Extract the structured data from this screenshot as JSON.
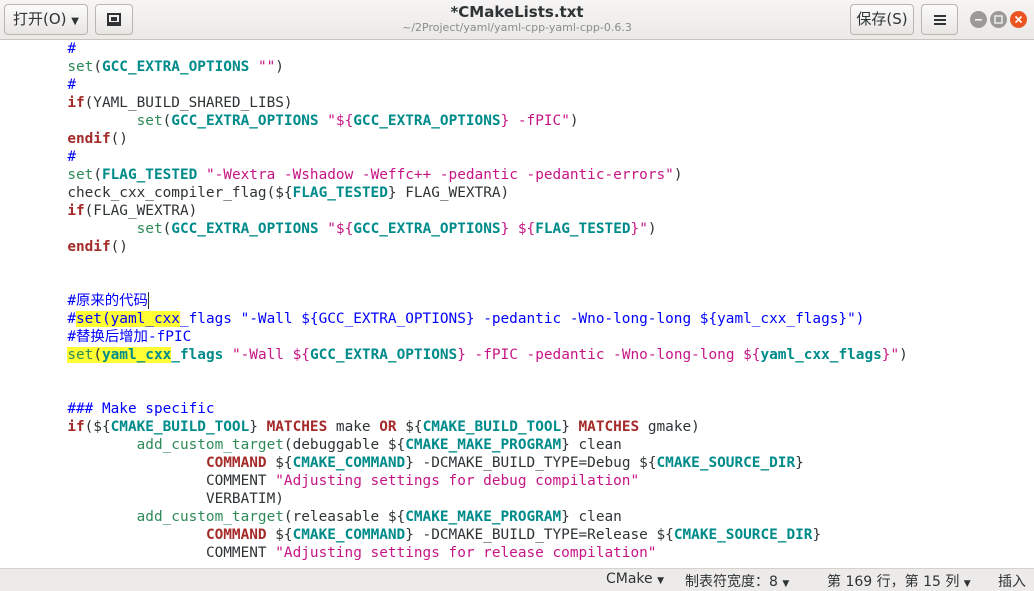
{
  "window": {
    "title": "*CMakeLists.txt",
    "subtitle": "~/2Project/yaml/yaml-cpp-yaml-cpp-0.6.3"
  },
  "toolbar": {
    "open_label": "打开(O)",
    "open_icon": "chevron-down-icon",
    "pin_icon": "document-pin-icon",
    "save_label": "保存(S)",
    "menu_icon": "hamburger-menu-icon"
  },
  "window_controls": {
    "minimize_icon": "minimize-icon",
    "maximize_icon": "maximize-icon",
    "close_icon": "close-icon",
    "close_color": "#e95420",
    "button_color": "#9c9a97"
  },
  "colors": {
    "keyword": "#a52a2a",
    "function": "#2e8b57",
    "variable": "#008b8b",
    "string": "#c71585",
    "comment": "#0000ff",
    "highlight": "#ffff33",
    "text": "#2e3436"
  },
  "editor": {
    "lines": [
      {
        "segments": [
          {
            "t": "\t#",
            "c": "comment"
          }
        ]
      },
      {
        "segments": [
          {
            "t": "\t"
          },
          {
            "t": "set",
            "c": "function"
          },
          {
            "t": "("
          },
          {
            "t": "GCC_EXTRA_OPTIONS",
            "c": "variable",
            "b": true
          },
          {
            "t": " "
          },
          {
            "t": "\"\"",
            "c": "string"
          },
          {
            "t": ")"
          }
        ]
      },
      {
        "segments": [
          {
            "t": "\t#",
            "c": "comment"
          }
        ]
      },
      {
        "segments": [
          {
            "t": "\t"
          },
          {
            "t": "if",
            "c": "keyword",
            "b": true
          },
          {
            "t": "(YAML_BUILD_SHARED_LIBS)"
          }
        ]
      },
      {
        "segments": [
          {
            "t": "\t\t"
          },
          {
            "t": "set",
            "c": "function"
          },
          {
            "t": "("
          },
          {
            "t": "GCC_EXTRA_OPTIONS",
            "c": "variable",
            "b": true
          },
          {
            "t": " "
          },
          {
            "t": "\"${",
            "c": "string"
          },
          {
            "t": "GCC_EXTRA_OPTIONS",
            "c": "variable",
            "b": true
          },
          {
            "t": "} -fPIC\"",
            "c": "string"
          },
          {
            "t": ")"
          }
        ]
      },
      {
        "segments": [
          {
            "t": "\t"
          },
          {
            "t": "endif",
            "c": "keyword",
            "b": true
          },
          {
            "t": "()"
          }
        ]
      },
      {
        "segments": [
          {
            "t": "\t#",
            "c": "comment"
          }
        ]
      },
      {
        "segments": [
          {
            "t": "\t"
          },
          {
            "t": "set",
            "c": "function"
          },
          {
            "t": "("
          },
          {
            "t": "FLAG_TESTED",
            "c": "variable",
            "b": true
          },
          {
            "t": " "
          },
          {
            "t": "\"-Wextra -Wshadow -Weffc++ -pedantic -pedantic-errors\"",
            "c": "string"
          },
          {
            "t": ")"
          }
        ]
      },
      {
        "segments": [
          {
            "t": "\tcheck_cxx_compiler_flag(${"
          },
          {
            "t": "FLAG_TESTED",
            "c": "variable",
            "b": true
          },
          {
            "t": "} FLAG_WEXTRA)"
          }
        ]
      },
      {
        "segments": [
          {
            "t": "\t"
          },
          {
            "t": "if",
            "c": "keyword",
            "b": true
          },
          {
            "t": "(FLAG_WEXTRA)"
          }
        ]
      },
      {
        "segments": [
          {
            "t": "\t\t"
          },
          {
            "t": "set",
            "c": "function"
          },
          {
            "t": "("
          },
          {
            "t": "GCC_EXTRA_OPTIONS",
            "c": "variable",
            "b": true
          },
          {
            "t": " "
          },
          {
            "t": "\"${",
            "c": "string"
          },
          {
            "t": "GCC_EXTRA_OPTIONS",
            "c": "variable",
            "b": true
          },
          {
            "t": "} ${",
            "c": "string"
          },
          {
            "t": "FLAG_TESTED",
            "c": "variable",
            "b": true
          },
          {
            "t": "}\"",
            "c": "string"
          },
          {
            "t": ")"
          }
        ]
      },
      {
        "segments": [
          {
            "t": "\t"
          },
          {
            "t": "endif",
            "c": "keyword",
            "b": true
          },
          {
            "t": "()"
          }
        ]
      },
      {
        "segments": [
          {
            "t": ""
          }
        ]
      },
      {
        "segments": [
          {
            "t": ""
          }
        ]
      },
      {
        "segments": [
          {
            "t": "\t#",
            "c": "comment"
          },
          {
            "t": "原来的代码",
            "c": "comment",
            "cjk": true
          },
          {
            "t": "|",
            "cursor": true
          }
        ]
      },
      {
        "segments": [
          {
            "t": "\t#",
            "c": "comment"
          },
          {
            "t": "set(yaml_cxx",
            "c": "comment",
            "hl": true
          },
          {
            "t": "_flags \"-Wall ${GCC_EXTRA_OPTIONS} -pedantic -Wno-long-long ${yaml_cxx_flags}\")",
            "c": "comment"
          }
        ]
      },
      {
        "segments": [
          {
            "t": "\t#",
            "c": "comment"
          },
          {
            "t": "替换后增加",
            "c": "comment",
            "cjk": true
          },
          {
            "t": "-fPIC",
            "c": "comment"
          }
        ]
      },
      {
        "segments": [
          {
            "t": "\t"
          },
          {
            "t": "set",
            "c": "function",
            "hl": true
          },
          {
            "t": "(",
            "hl": true
          },
          {
            "t": "yaml_cxx",
            "c": "variable",
            "b": true,
            "hl": true
          },
          {
            "t": "_flags",
            "c": "variable",
            "b": true
          },
          {
            "t": " "
          },
          {
            "t": "\"-Wall ${",
            "c": "string"
          },
          {
            "t": "GCC_EXTRA_OPTIONS",
            "c": "variable",
            "b": true
          },
          {
            "t": "} -fPIC -pedantic -Wno-long-long ${",
            "c": "string"
          },
          {
            "t": "yaml_cxx_flags",
            "c": "variable",
            "b": true
          },
          {
            "t": "}\"",
            "c": "string"
          },
          {
            "t": ")"
          }
        ]
      },
      {
        "segments": [
          {
            "t": ""
          }
        ]
      },
      {
        "segments": [
          {
            "t": ""
          }
        ]
      },
      {
        "segments": [
          {
            "t": "\t### Make specific",
            "c": "comment"
          }
        ]
      },
      {
        "segments": [
          {
            "t": "\t"
          },
          {
            "t": "if",
            "c": "keyword",
            "b": true
          },
          {
            "t": "(${"
          },
          {
            "t": "CMAKE_BUILD_TOOL",
            "c": "variable",
            "b": true
          },
          {
            "t": "} "
          },
          {
            "t": "MATCHES",
            "c": "keyword",
            "b": true
          },
          {
            "t": " make "
          },
          {
            "t": "OR",
            "c": "keyword",
            "b": true
          },
          {
            "t": " ${"
          },
          {
            "t": "CMAKE_BUILD_TOOL",
            "c": "variable",
            "b": true
          },
          {
            "t": "} "
          },
          {
            "t": "MATCHES",
            "c": "keyword",
            "b": true
          },
          {
            "t": " gmake)"
          }
        ]
      },
      {
        "segments": [
          {
            "t": "\t\t"
          },
          {
            "t": "add_custom_target",
            "c": "function"
          },
          {
            "t": "(debuggable ${"
          },
          {
            "t": "CMAKE_MAKE_PROGRAM",
            "c": "variable",
            "b": true
          },
          {
            "t": "} clean"
          }
        ]
      },
      {
        "segments": [
          {
            "t": "\t\t\t"
          },
          {
            "t": "COMMAND",
            "c": "keyword",
            "b": true
          },
          {
            "t": " ${"
          },
          {
            "t": "CMAKE_COMMAND",
            "c": "variable",
            "b": true
          },
          {
            "t": "} -DCMAKE_BUILD_TYPE=Debug ${"
          },
          {
            "t": "CMAKE_SOURCE_DIR",
            "c": "variable",
            "b": true
          },
          {
            "t": "}"
          }
        ]
      },
      {
        "segments": [
          {
            "t": "\t\t\tCOMMENT "
          },
          {
            "t": "\"Adjusting settings for debug compilation\"",
            "c": "string"
          }
        ]
      },
      {
        "segments": [
          {
            "t": "\t\t\tVERBATIM)"
          }
        ]
      },
      {
        "segments": [
          {
            "t": "\t\t"
          },
          {
            "t": "add_custom_target",
            "c": "function"
          },
          {
            "t": "(releasable ${"
          },
          {
            "t": "CMAKE_MAKE_PROGRAM",
            "c": "variable",
            "b": true
          },
          {
            "t": "} clean"
          }
        ]
      },
      {
        "segments": [
          {
            "t": "\t\t\t"
          },
          {
            "t": "COMMAND",
            "c": "keyword",
            "b": true
          },
          {
            "t": " ${"
          },
          {
            "t": "CMAKE_COMMAND",
            "c": "variable",
            "b": true
          },
          {
            "t": "} -DCMAKE_BUILD_TYPE=Release ${"
          },
          {
            "t": "CMAKE_SOURCE_DIR",
            "c": "variable",
            "b": true
          },
          {
            "t": "}"
          }
        ]
      },
      {
        "segments": [
          {
            "t": "\t\t\tCOMMENT "
          },
          {
            "t": "\"Adjusting settings for release compilation\"",
            "c": "string"
          }
        ]
      }
    ]
  },
  "statusbar": {
    "language": "CMake",
    "tab_width": "制表符宽度：8",
    "position": "第 169 行，第 15 列",
    "mode": "插入",
    "dropdown_icon": "triangle-down-icon"
  }
}
